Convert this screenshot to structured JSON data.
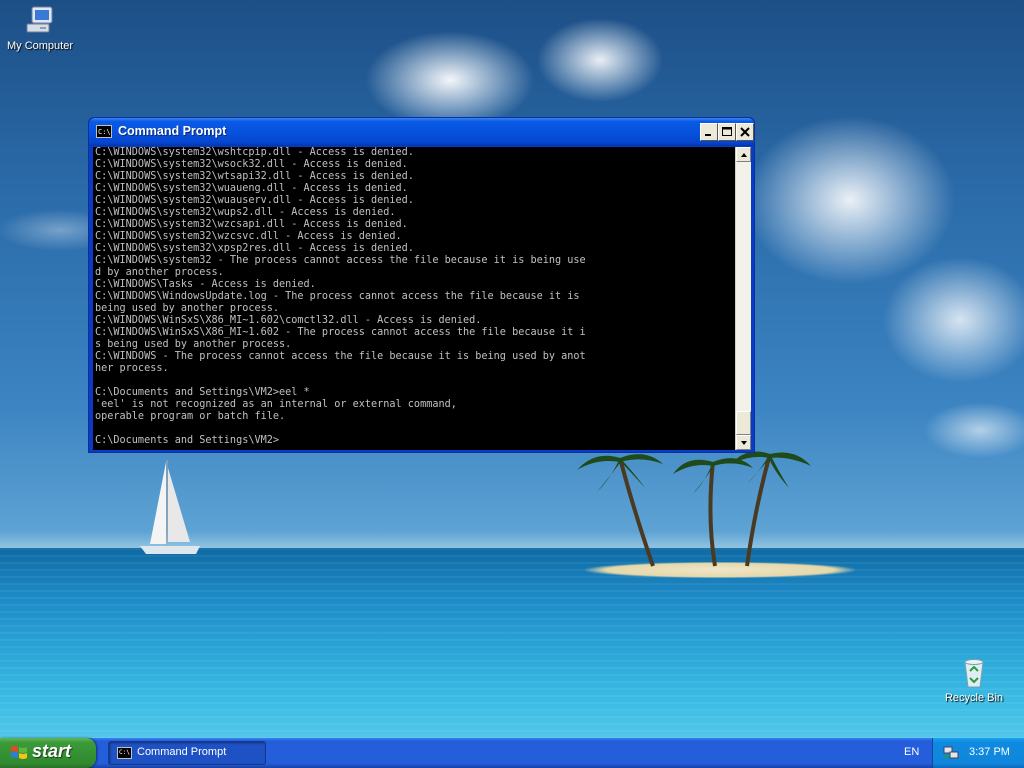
{
  "desktop": {
    "icons": [
      {
        "label": "My Computer",
        "icon": "my-computer-icon"
      },
      {
        "label": "Recycle Bin",
        "icon": "recycle-bin-icon"
      }
    ]
  },
  "window": {
    "title": "Command Prompt",
    "icon": "cmd-icon",
    "icon_text": "C:\\",
    "controls": {
      "minimize": "minimize-icon",
      "maximize": "maximize-icon",
      "close": "close-icon"
    },
    "output": "C:\\WINDOWS\\system32\\wshtcpip.dll - Access is denied.\nC:\\WINDOWS\\system32\\wsock32.dll - Access is denied.\nC:\\WINDOWS\\system32\\wtsapi32.dll - Access is denied.\nC:\\WINDOWS\\system32\\wuaueng.dll - Access is denied.\nC:\\WINDOWS\\system32\\wuauserv.dll - Access is denied.\nC:\\WINDOWS\\system32\\wups2.dll - Access is denied.\nC:\\WINDOWS\\system32\\wzcsapi.dll - Access is denied.\nC:\\WINDOWS\\system32\\wzcsvc.dll - Access is denied.\nC:\\WINDOWS\\system32\\xpsp2res.dll - Access is denied.\nC:\\WINDOWS\\system32 - The process cannot access the file because it is being use\nd by another process.\nC:\\WINDOWS\\Tasks - Access is denied.\nC:\\WINDOWS\\WindowsUpdate.log - The process cannot access the file because it is\nbeing used by another process.\nC:\\WINDOWS\\WinSxS\\X86_MI~1.602\\comctl32.dll - Access is denied.\nC:\\WINDOWS\\WinSxS\\X86_MI~1.602 - The process cannot access the file because it i\ns being used by another process.\nC:\\WINDOWS - The process cannot access the file because it is being used by anot\nher process.\n\nC:\\Documents and Settings\\VM2>eel *\n'eel' is not recognized as an internal or external command,\noperable program or batch file.\n\nC:\\Documents and Settings\\VM2>"
  },
  "taskbar": {
    "start_label": "start",
    "tasks": [
      {
        "label": "Command Prompt",
        "icon": "cmd-icon",
        "icon_text": "C:\\",
        "active": true
      }
    ],
    "language": "EN",
    "tray_icons": [
      "network-icon"
    ],
    "clock": "3:37 PM"
  },
  "colors": {
    "console_bg": "#000000",
    "console_fg": "#c0c0c0",
    "titlebar": "#0652de",
    "taskbar": "#245edb",
    "start_button": "#3c9a3a",
    "tray": "#0f86dc"
  }
}
